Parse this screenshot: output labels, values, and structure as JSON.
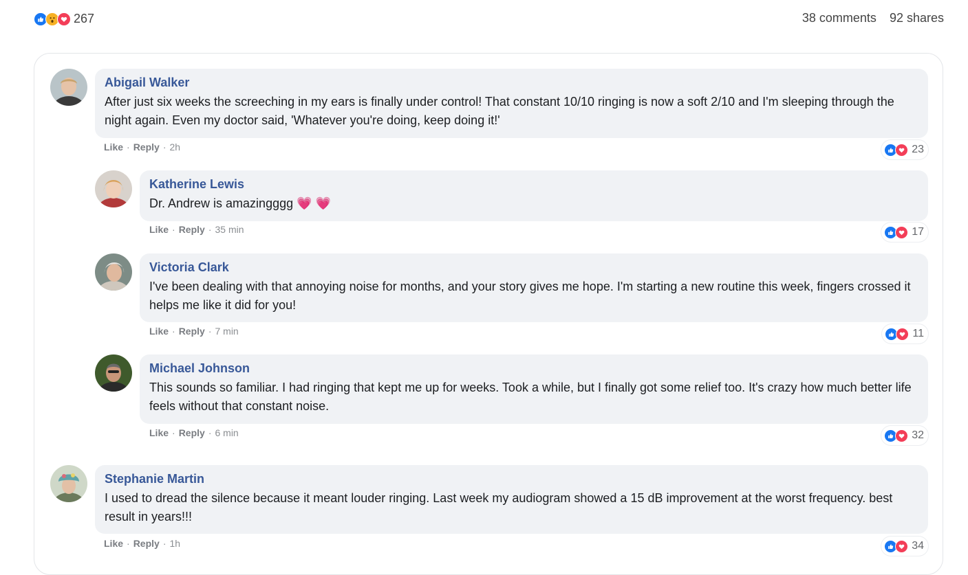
{
  "post": {
    "reaction_total": "267",
    "comments_count": "38 comments",
    "shares_count": "92 shares",
    "reaction_icons": [
      "like-icon",
      "wow-icon",
      "love-icon"
    ]
  },
  "actions": {
    "like": "Like",
    "reply": "Reply",
    "dot": "·"
  },
  "colors": {
    "like": "#1877f2",
    "love": "#f33e58",
    "wow": "#f7b125",
    "author": "#385898",
    "bubble": "#f0f2f5"
  },
  "comments": [
    {
      "author": "Abigail Walker",
      "text": "After just six weeks the screeching in my ears is finally under control! That constant 10/10 ringing is now a soft 2/10 and I'm sleeping through the night again. Even my doctor said, 'Whatever you're doing, keep doing it!'",
      "time": "2h",
      "reactions": "23"
    },
    {
      "author": "Katherine Lewis",
      "text": "Dr. Andrew is amazingggg 💗 💗",
      "time": "35 min",
      "reactions": "17"
    },
    {
      "author": "Victoria Clark",
      "text": "I've been dealing with that annoying noise for months, and your story gives me hope. I'm starting a new routine this week, fingers crossed it helps me like it did for you!",
      "time": "7 min",
      "reactions": "11"
    },
    {
      "author": "Michael Johnson",
      "text": "This sounds so familiar. I had ringing that kept me up for weeks. Took a while, but I finally got some relief too. It's crazy how much better life feels without that constant noise.",
      "time": "6 min",
      "reactions": "32"
    },
    {
      "author": "Stephanie Martin",
      "text": "I used to dread the silence because it meant louder ringing. Last week my audiogram showed a 15 dB improvement at the worst frequency. best result in years!!!",
      "time": "1h",
      "reactions": "34"
    }
  ]
}
